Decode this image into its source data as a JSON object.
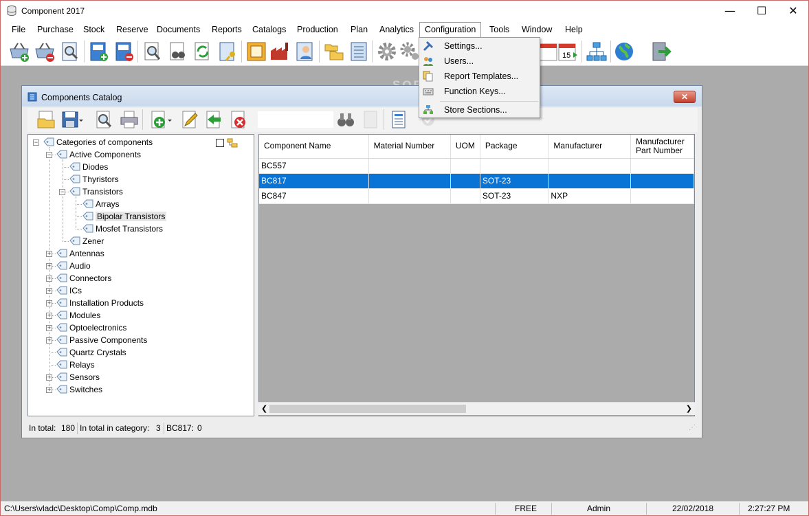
{
  "app": {
    "title": "Component 2017"
  },
  "window_controls": {
    "minimize": "—",
    "maximize": "☐",
    "close": "✕"
  },
  "menu": [
    "File",
    "Purchase",
    "Stock",
    "Reserve",
    "Documents",
    "Reports",
    "Catalogs",
    "Production",
    "Plan",
    "Analytics",
    "Configuration",
    "Tools",
    "Window",
    "Help"
  ],
  "config_menu": {
    "items": [
      "Settings...",
      "Users...",
      "Report Templates...",
      "Function Keys...",
      "Store Sections..."
    ]
  },
  "toolbar_icons": [
    "basket-add-icon",
    "basket-remove-icon",
    "basket-search-icon",
    "doc-add-icon",
    "doc-remove-icon",
    "page-search-icon",
    "binoculars-icon",
    "refresh-icon",
    "key-book-icon",
    "frame-icon",
    "factory-icon",
    "worker-book-icon",
    "folders-icon",
    "notebook-icon",
    "gear-icon",
    "gears-icon",
    "tools-icon",
    "people-icon",
    "calendar-icon",
    "calendar-15-icon",
    "org-chart-icon",
    "globe-icon",
    "exit-icon"
  ],
  "watermark": "SOFTPEDIA",
  "catalog": {
    "title": "Components Catalog",
    "close": "✕",
    "tree": {
      "root": "Categories of components",
      "nodes": [
        {
          "label": "Active Components",
          "level": 1
        },
        {
          "label": "Diodes",
          "level": 2
        },
        {
          "label": "Thyristors",
          "level": 2
        },
        {
          "label": "Transistors",
          "level": 2
        },
        {
          "label": "Arrays",
          "level": 3
        },
        {
          "label": "Bipolar Transistors",
          "level": 3
        },
        {
          "label": "Mosfet Transistors",
          "level": 3
        },
        {
          "label": "Zener",
          "level": 2
        },
        {
          "label": "Antennas",
          "level": 1
        },
        {
          "label": "Audio",
          "level": 1
        },
        {
          "label": "Connectors",
          "level": 1
        },
        {
          "label": "ICs",
          "level": 1
        },
        {
          "label": "Installation Products",
          "level": 1
        },
        {
          "label": "Modules",
          "level": 1
        },
        {
          "label": "Optoelectronics",
          "level": 1
        },
        {
          "label": "Passive Components",
          "level": 1
        },
        {
          "label": "Quartz Crystals",
          "level": 1
        },
        {
          "label": "Relays",
          "level": 1
        },
        {
          "label": "Sensors",
          "level": 1
        },
        {
          "label": "Switches",
          "level": 1
        }
      ]
    },
    "columns": [
      "Component Name",
      "Material Number",
      "UOM",
      "Package",
      "Manufacturer",
      "Manufacturer Part Number"
    ],
    "rows": [
      [
        "BC557",
        "",
        "",
        "",
        "",
        ""
      ],
      [
        "BC817",
        "",
        "",
        "SOT-23",
        "",
        ""
      ],
      [
        "BC847",
        "",
        "",
        "SOT-23",
        "NXP",
        ""
      ]
    ],
    "selected_row": 1,
    "status": {
      "total_label": "In total:",
      "total_value": "180",
      "category_label": "In total in category:",
      "category_value": "3",
      "item_label": "BC817:",
      "item_value": "0"
    }
  },
  "statusbar": {
    "path": "C:\\Users\\vladc\\Desktop\\Comp\\Comp.mdb",
    "mode": "FREE",
    "user": "Admin",
    "date": "22/02/2018",
    "time": "2:27:27 PM"
  }
}
